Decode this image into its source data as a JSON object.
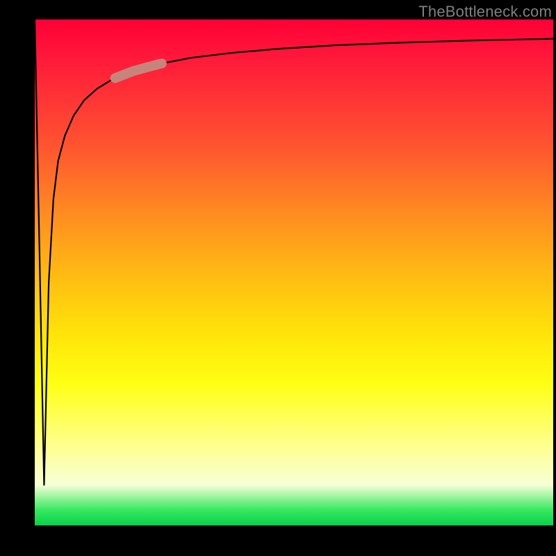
{
  "watermark": "TheBottleneck.com",
  "chart_data": {
    "type": "line",
    "title": "",
    "xlabel": "",
    "ylabel": "",
    "xlim": [
      0,
      100
    ],
    "ylim": [
      0,
      100
    ],
    "series": [
      {
        "name": "curve",
        "x": [
          0,
          0.9,
          1.8,
          2.7,
          3.6,
          4.5,
          5.8,
          7.5,
          9.5,
          12,
          15,
          19,
          24,
          30,
          38,
          47,
          58,
          70,
          83,
          96,
          100
        ],
        "values": [
          100,
          55,
          8,
          48,
          64.5,
          72,
          77,
          81,
          84,
          86.3,
          88.2,
          89.8,
          91.2,
          92.4,
          93.4,
          94.2,
          94.9,
          95.4,
          95.8,
          96.1,
          96.2
        ]
      }
    ],
    "highlight_segment": {
      "x_start": 15.5,
      "x_end": 24.5
    }
  },
  "colors": {
    "curve": "#000000",
    "highlight": "#c7847d"
  }
}
